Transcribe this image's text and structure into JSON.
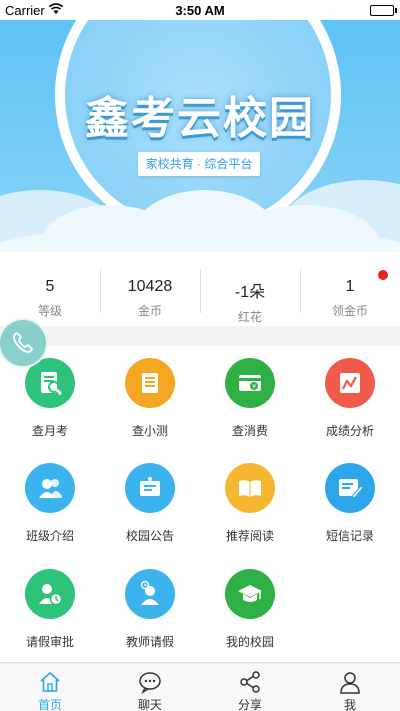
{
  "statusbar": {
    "carrier": "Carrier",
    "time": "3:50 AM"
  },
  "banner": {
    "title": "鑫考云校园",
    "subtitle": "家校共育 · 综合平台"
  },
  "stats": [
    {
      "value": "5",
      "label": "等级"
    },
    {
      "value": "10428",
      "label": "金币"
    },
    {
      "value": "-1朵",
      "label": "红花"
    },
    {
      "value": "1",
      "label": "领金币"
    }
  ],
  "grid": [
    {
      "label": "查月考",
      "icon": "exam-doc-icon",
      "color": "#2ec27a"
    },
    {
      "label": "查小测",
      "icon": "quiz-list-icon",
      "color": "#f5a623"
    },
    {
      "label": "查消费",
      "icon": "consumption-card-icon",
      "color": "#2fb044"
    },
    {
      "label": "成绩分析",
      "icon": "chart-analysis-icon",
      "color": "#f05a4b"
    },
    {
      "label": "班级介绍",
      "icon": "class-group-icon",
      "color": "#3ab3ee"
    },
    {
      "label": "校园公告",
      "icon": "notice-board-icon",
      "color": "#3ab3ee"
    },
    {
      "label": "推荐阅读",
      "icon": "open-book-icon",
      "color": "#f5b731"
    },
    {
      "label": "短信记录",
      "icon": "sms-edit-icon",
      "color": "#2ca6e9"
    },
    {
      "label": "请假审批",
      "icon": "leave-approval-icon",
      "color": "#2ec27a"
    },
    {
      "label": "教师请假",
      "icon": "teacher-leave-icon",
      "color": "#3ab3ee"
    },
    {
      "label": "我的校园",
      "icon": "graduation-cap-icon",
      "color": "#2fb044"
    }
  ],
  "tabs": [
    {
      "label": "首页",
      "icon": "home-icon",
      "active": true
    },
    {
      "label": "聊天",
      "icon": "chat-icon",
      "active": false
    },
    {
      "label": "分享",
      "icon": "share-icon",
      "active": false
    },
    {
      "label": "我",
      "icon": "user-icon",
      "active": false
    }
  ],
  "colors": {
    "accent": "#2aa7e6",
    "badge": "#e8231e"
  }
}
